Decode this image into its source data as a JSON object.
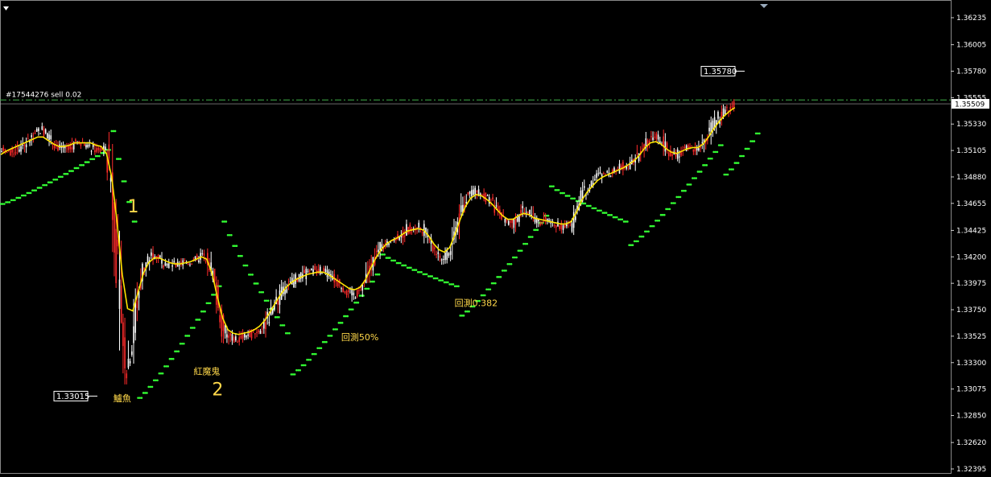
{
  "chart_data": {
    "type": "candlestick",
    "ylim": [
      1.32395,
      1.36235
    ],
    "yticks": [
      "1.36235",
      "1.36005",
      "1.35780",
      "1.35555",
      "1.35330",
      "1.35105",
      "1.34880",
      "1.34655",
      "1.34425",
      "1.34200",
      "1.33975",
      "1.33750",
      "1.33525",
      "1.33300",
      "1.33075",
      "1.32850",
      "1.32620",
      "1.32395"
    ],
    "current_price": "1.35509",
    "order_line": {
      "label": "#17544276 sell 0.02",
      "price": 1.35535
    },
    "high_marker": {
      "label": "1.35780",
      "price": 1.3578
    },
    "low_marker": {
      "label": "1.33015",
      "price": 1.33015
    },
    "price_series": [
      1.3511,
      1.3509,
      1.3508,
      1.3512,
      1.3515,
      1.3518,
      1.3521,
      1.3526,
      1.3529,
      1.3524,
      1.3517,
      1.3513,
      1.3512,
      1.3514,
      1.3518,
      1.3518,
      1.3516,
      1.3513,
      1.3512,
      1.3512,
      1.3511,
      1.3488,
      1.3425,
      1.336,
      1.3325,
      1.3348,
      1.3385,
      1.3408,
      1.3418,
      1.3421,
      1.342,
      1.3415,
      1.3414,
      1.3412,
      1.3414,
      1.3415,
      1.3416,
      1.3418,
      1.3421,
      1.3419,
      1.341,
      1.3388,
      1.3365,
      1.3353,
      1.335,
      1.335,
      1.3352,
      1.3354,
      1.3355,
      1.3358,
      1.3362,
      1.337,
      1.3378,
      1.3388,
      1.3393,
      1.3397,
      1.3401,
      1.3404,
      1.3406,
      1.3408,
      1.341,
      1.3408,
      1.3406,
      1.3402,
      1.3398,
      1.3394,
      1.339,
      1.3388,
      1.339,
      1.3398,
      1.341,
      1.342,
      1.3428,
      1.3432,
      1.3434,
      1.3436,
      1.344,
      1.3443,
      1.3445,
      1.3446,
      1.3444,
      1.3437,
      1.3428,
      1.3421,
      1.3418,
      1.3424,
      1.344,
      1.3455,
      1.3468,
      1.3475,
      1.3477,
      1.3474,
      1.347,
      1.3466,
      1.346,
      1.3454,
      1.3448,
      1.3449,
      1.3455,
      1.346,
      1.3457,
      1.3452,
      1.345,
      1.3451,
      1.345,
      1.3449,
      1.3446,
      1.3446,
      1.3447,
      1.3458,
      1.347,
      1.3478,
      1.3483,
      1.3488,
      1.349,
      1.3491,
      1.3493,
      1.3495,
      1.3497,
      1.3499,
      1.3502,
      1.3507,
      1.3515,
      1.352,
      1.3522,
      1.3519,
      1.3513,
      1.3509,
      1.3507,
      1.351,
      1.3513,
      1.3514,
      1.3512,
      1.3516,
      1.3523,
      1.3532,
      1.3538,
      1.3544,
      1.3546,
      1.355
    ],
    "ma_series": [
      1.3507,
      1.351,
      1.3512,
      1.3514,
      1.3516,
      1.3518,
      1.352,
      1.3522,
      1.3522,
      1.3519,
      1.3516,
      1.3514,
      1.3514,
      1.3515,
      1.3517,
      1.3517,
      1.3517,
      1.3517,
      1.3515,
      1.3514,
      1.3508,
      1.3488,
      1.345,
      1.3405,
      1.3376,
      1.3374,
      1.339,
      1.3406,
      1.3415,
      1.3419,
      1.3419,
      1.3417,
      1.3415,
      1.3414,
      1.3414,
      1.3415,
      1.3416,
      1.3418,
      1.342,
      1.3418,
      1.3406,
      1.3386,
      1.3368,
      1.3358,
      1.3355,
      1.3354,
      1.3355,
      1.3356,
      1.3358,
      1.3361,
      1.3366,
      1.3373,
      1.3381,
      1.3388,
      1.3394,
      1.3398,
      1.3401,
      1.3403,
      1.3405,
      1.3406,
      1.3407,
      1.3407,
      1.3405,
      1.3402,
      1.3399,
      1.3396,
      1.3393,
      1.3392,
      1.3394,
      1.34,
      1.341,
      1.3419,
      1.3426,
      1.3431,
      1.3434,
      1.3436,
      1.3439,
      1.3442,
      1.3443,
      1.3444,
      1.3443,
      1.3438,
      1.3431,
      1.3426,
      1.3424,
      1.3428,
      1.3439,
      1.3452,
      1.3463,
      1.347,
      1.3473,
      1.3472,
      1.3469,
      1.3465,
      1.346,
      1.3455,
      1.3452,
      1.3452,
      1.3455,
      1.3457,
      1.3456,
      1.3453,
      1.3452,
      1.3451,
      1.345,
      1.3449,
      1.3448,
      1.3448,
      1.345,
      1.3458,
      1.3468,
      1.3475,
      1.348,
      1.3485,
      1.3488,
      1.349,
      1.3492,
      1.3494,
      1.3496,
      1.3499,
      1.3502,
      1.3507,
      1.3513,
      1.3517,
      1.3518,
      1.3516,
      1.3512,
      1.3509,
      1.3508,
      1.351,
      1.3512,
      1.3513,
      1.3513,
      1.3516,
      1.3522,
      1.3529,
      1.3535,
      1.354,
      1.3544,
      1.3547
    ],
    "sar_segments": [
      {
        "x": [
          0,
          20
        ],
        "y": [
          1.3465,
          1.3511
        ]
      },
      {
        "x": [
          21,
          25
        ],
        "y": [
          1.3527,
          1.345
        ]
      },
      {
        "x": [
          26,
          41
        ],
        "y": [
          1.33,
          1.3395
        ]
      },
      {
        "x": [
          42,
          54
        ],
        "y": [
          1.345,
          1.3355
        ]
      },
      {
        "x": [
          55,
          71
        ],
        "y": [
          1.332,
          1.3405
        ]
      },
      {
        "x": [
          72,
          86
        ],
        "y": [
          1.3422,
          1.3395
        ]
      },
      {
        "x": [
          87,
          103
        ],
        "y": [
          1.337,
          1.3455
        ]
      },
      {
        "x": [
          104,
          118
        ],
        "y": [
          1.348,
          1.345
        ]
      },
      {
        "x": [
          119,
          136
        ],
        "y": [
          1.343,
          1.3515
        ]
      },
      {
        "x": [
          137,
          143
        ],
        "y": [
          1.349,
          1.3525
        ]
      }
    ],
    "annotations": [
      {
        "text": "1",
        "x": 24,
        "price": 1.3458,
        "style": "big"
      },
      {
        "text": "鱸魚",
        "x": 23,
        "price": 1.3297,
        "style": "small"
      },
      {
        "text": "紅魔鬼",
        "x": 39,
        "price": 1.332,
        "style": "small"
      },
      {
        "text": "2",
        "x": 40,
        "price": 1.3302,
        "style": "big"
      },
      {
        "text": "回測50%",
        "x": 68,
        "price": 1.3349,
        "style": "small"
      },
      {
        "text": "回測0.382",
        "x": 90,
        "price": 1.3378,
        "style": "small"
      }
    ],
    "colors": {
      "bull": "#ffffff",
      "bear": "#ff2b2b",
      "ma": "#ffe600",
      "sar": "#33ff33",
      "order": "#3fae49",
      "grid": "#808080"
    }
  }
}
